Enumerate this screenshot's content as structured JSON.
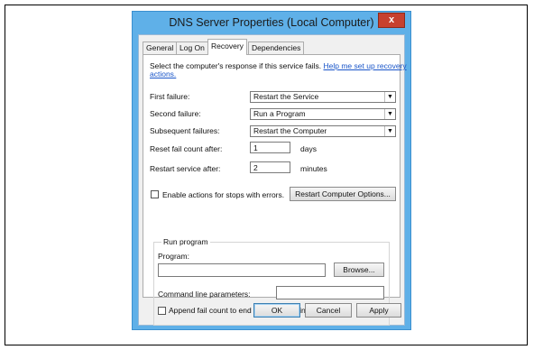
{
  "window": {
    "title": "DNS Server Properties (Local Computer)",
    "close_glyph": "x"
  },
  "tabs": [
    {
      "label": "General"
    },
    {
      "label": "Log On"
    },
    {
      "label": "Recovery"
    },
    {
      "label": "Dependencies"
    }
  ],
  "active_tab": "Recovery",
  "recovery": {
    "intro_line1": "Select the computer's response if this service fails.",
    "help_link": "Help me set up recovery",
    "help_link_cont": "actions.",
    "first_failure": {
      "label": "First failure:",
      "value": "Restart the Service"
    },
    "second_failure": {
      "label": "Second failure:",
      "value": "Run a Program"
    },
    "subsequent_failures": {
      "label": "Subsequent failures:",
      "value": "Restart the Computer"
    },
    "reset_fail_count": {
      "label": "Reset fail count after:",
      "value": "1",
      "unit": "days"
    },
    "restart_service": {
      "label": "Restart service after:",
      "value": "2",
      "unit": "minutes"
    },
    "enable_actions": {
      "label": "Enable actions for stops with errors.",
      "checked": false
    },
    "restart_computer_options_label": "Restart Computer Options...",
    "run_program": {
      "group_title": "Run program",
      "program_label": "Program:",
      "program_value": "",
      "browse_label": "Browse...",
      "cmdline_label": "Command line parameters:",
      "cmdline_value": "",
      "append_label": "Append fail count to end of command line (/fail=%1%)",
      "append_checked": false
    }
  },
  "footer": {
    "ok_label": "OK",
    "cancel_label": "Cancel",
    "apply_label": "Apply"
  }
}
